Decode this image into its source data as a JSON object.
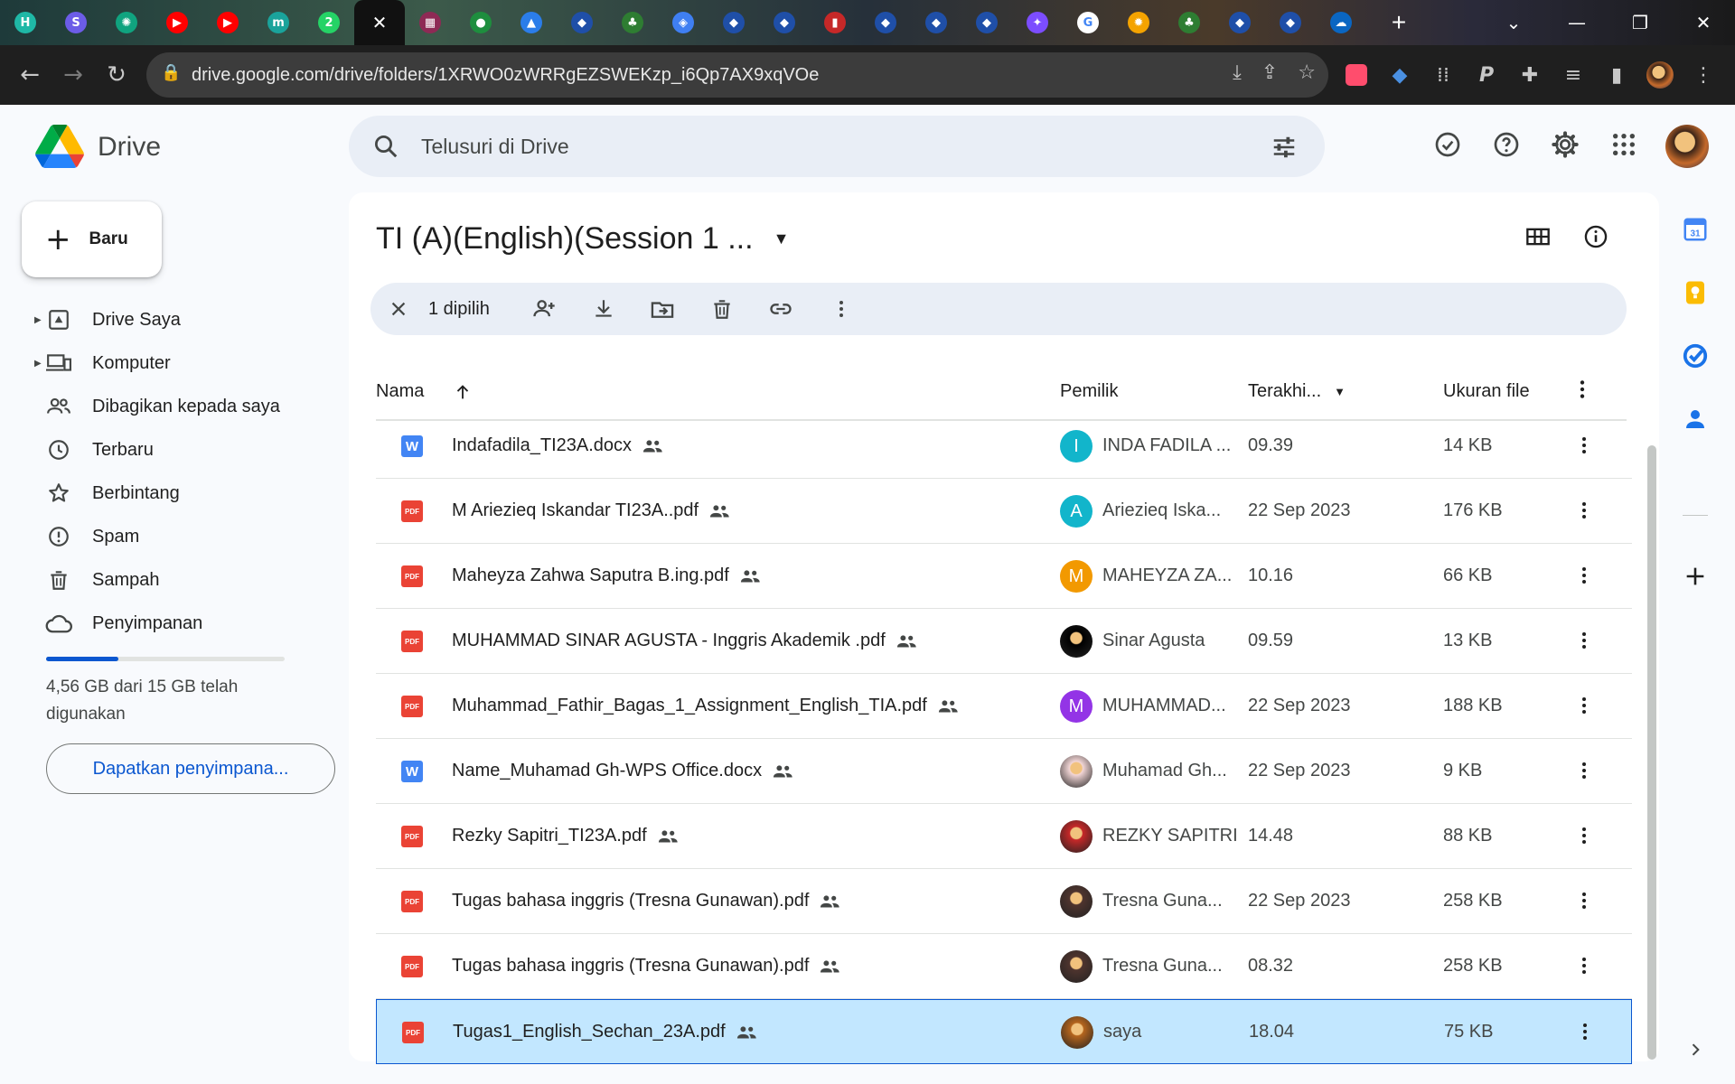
{
  "browser": {
    "tabs": [
      {
        "icon": "h-app-icon",
        "color": "#1fb8a6",
        "glyph": "H"
      },
      {
        "icon": "s-app-icon",
        "color": "#6c5ce7",
        "glyph": "S"
      },
      {
        "icon": "chatgpt-icon",
        "color": "#10a37f",
        "glyph": "✺"
      },
      {
        "icon": "youtube-icon",
        "color": "#ff0000",
        "glyph": "▶"
      },
      {
        "icon": "youtube-icon",
        "color": "#ff0000",
        "glyph": "▶"
      },
      {
        "icon": "m-app-icon",
        "color": "#1aa39b",
        "glyph": "m"
      },
      {
        "icon": "whatsapp-icon",
        "color": "#25d366",
        "glyph": "2"
      },
      {
        "icon": "close-icon",
        "color": "#111111",
        "glyph": "✕"
      },
      {
        "icon": "app-icon",
        "color": "#8e2a55",
        "glyph": "▦"
      },
      {
        "icon": "meet-icon",
        "color": "#1e8e3e",
        "glyph": "●"
      },
      {
        "icon": "drive-icon",
        "color": "#2b7de9",
        "glyph": "▲"
      },
      {
        "icon": "site-icon",
        "color": "#1f4fa8",
        "glyph": "◆"
      },
      {
        "icon": "site-icon",
        "color": "#2e7d32",
        "glyph": "♣"
      },
      {
        "icon": "classroom-icon",
        "color": "#3f7ff2",
        "glyph": "◈"
      },
      {
        "icon": "site-icon",
        "color": "#1f4fa8",
        "glyph": "◆"
      },
      {
        "icon": "site-icon",
        "color": "#1f4fa8",
        "glyph": "◆"
      },
      {
        "icon": "site-icon",
        "color": "#c62828",
        "glyph": "▮"
      },
      {
        "icon": "site-icon",
        "color": "#1f4fa8",
        "glyph": "◆"
      },
      {
        "icon": "site-icon",
        "color": "#1f4fa8",
        "glyph": "◆"
      },
      {
        "icon": "site-icon",
        "color": "#1f4fa8",
        "glyph": "◆"
      },
      {
        "icon": "gemini-icon",
        "color": "#7c4dff",
        "glyph": "✦"
      },
      {
        "icon": "google-icon",
        "color": "#ffffff",
        "glyph": "G"
      },
      {
        "icon": "sun-icon",
        "color": "#f4a300",
        "glyph": "✹"
      },
      {
        "icon": "site-icon",
        "color": "#2e7d32",
        "glyph": "♣"
      },
      {
        "icon": "site-icon",
        "color": "#1f4fa8",
        "glyph": "◆"
      },
      {
        "icon": "site-icon",
        "color": "#1f4fa8",
        "glyph": "◆"
      },
      {
        "icon": "onedrive-icon",
        "color": "#0a66c2",
        "glyph": "☁"
      }
    ],
    "url": "drive.google.com/drive/folders/1XRWO0zWRRgEZSWEKzp_i6Qp7AX9xqVOe"
  },
  "app": {
    "brand": "Drive",
    "search_placeholder": "Telusuri di Drive"
  },
  "sidebar": {
    "new_label": "Baru",
    "items": [
      {
        "label": "Drive Saya",
        "icon": "my-drive-icon",
        "caret": true
      },
      {
        "label": "Komputer",
        "icon": "computers-icon",
        "caret": true
      },
      {
        "label": "Dibagikan kepada saya",
        "icon": "shared-icon",
        "caret": false
      },
      {
        "label": "Terbaru",
        "icon": "clock-icon",
        "caret": false
      },
      {
        "label": "Berbintang",
        "icon": "star-icon",
        "caret": false
      },
      {
        "label": "Spam",
        "icon": "spam-icon",
        "caret": false
      },
      {
        "label": "Sampah",
        "icon": "trash-icon",
        "caret": false
      },
      {
        "label": "Penyimpanan",
        "icon": "cloud-icon",
        "caret": false
      }
    ],
    "storage_used_fraction": 0.304,
    "storage_text": "4,56 GB dari 15 GB telah digunakan",
    "get_storage_label": "Dapatkan penyimpana..."
  },
  "main": {
    "folder_title": "TI (A)(English)(Session 1 ...",
    "selection_count": "1 dipilih",
    "columns": {
      "name": "Nama",
      "owner": "Pemilik",
      "modified": "Terakhi...",
      "size": "Ukuran file"
    },
    "files": [
      {
        "name": "Indafadila_TI23A.docx",
        "type": "word",
        "owner": "INDA FADILA ...",
        "owner_initial": "I",
        "owner_color": "#12b5cb",
        "modified": "09.39",
        "size": "14 KB",
        "selected": false
      },
      {
        "name": "M Ariezieq Iskandar TI23A..pdf",
        "type": "pdf",
        "owner": "Ariezieq Iska...",
        "owner_initial": "A",
        "owner_color": "#12b5cb",
        "modified": "22 Sep 2023",
        "size": "176 KB",
        "selected": false
      },
      {
        "name": "Maheyza Zahwa Saputra B.ing.pdf",
        "type": "pdf",
        "owner": "MAHEYZA ZA...",
        "owner_initial": "M",
        "owner_color": "#f29900",
        "modified": "10.16",
        "size": "66 KB",
        "selected": false
      },
      {
        "name": "MUHAMMAD SINAR AGUSTA - Inggris Akademik .pdf",
        "type": "pdf",
        "owner": "Sinar Agusta",
        "owner_initial": "",
        "owner_color": "#000000",
        "modified": "09.59",
        "size": "13 KB",
        "selected": false
      },
      {
        "name": "Muhammad_Fathir_Bagas_1_Assignment_English_TIA.pdf",
        "type": "pdf",
        "owner": "MUHAMMAD...",
        "owner_initial": "M",
        "owner_color": "#9334e6",
        "modified": "22 Sep 2023",
        "size": "188 KB",
        "selected": false
      },
      {
        "name": "Name_Muhamad Gh-WPS Office.docx",
        "type": "word",
        "owner": "Muhamad Gh...",
        "owner_initial": "",
        "owner_color": "#f3d6d6",
        "modified": "22 Sep 2023",
        "size": "9 KB",
        "selected": false
      },
      {
        "name": "Rezky Sapitri_TI23A.pdf",
        "type": "pdf",
        "owner": "REZKY SAPITRI",
        "owner_initial": "",
        "owner_color": "#c62828",
        "modified": "14.48",
        "size": "88 KB",
        "selected": false
      },
      {
        "name": "Tugas bahasa inggris (Tresna Gunawan).pdf",
        "type": "pdf",
        "owner": "Tresna Guna...",
        "owner_initial": "",
        "owner_color": "#4e342e",
        "modified": "22 Sep 2023",
        "size": "258 KB",
        "selected": false
      },
      {
        "name": "Tugas bahasa inggris (Tresna Gunawan).pdf",
        "type": "pdf",
        "owner": "Tresna Guna...",
        "owner_initial": "",
        "owner_color": "#4e342e",
        "modified": "08.32",
        "size": "258 KB",
        "selected": false
      },
      {
        "name": "Tugas1_English_Sechan_23A.pdf",
        "type": "pdf",
        "owner": "saya",
        "owner_initial": "",
        "owner_color": "#b5651d",
        "modified": "18.04",
        "size": "75 KB",
        "selected": true
      }
    ]
  },
  "side_panel": [
    "calendar-icon",
    "keep-icon",
    "tasks-icon",
    "contacts-icon",
    "add-icon"
  ],
  "colors": {
    "accent": "#0b57d0",
    "selected_row": "#c2e7ff",
    "pdf": "#ea4335",
    "word": "#4285f4"
  }
}
